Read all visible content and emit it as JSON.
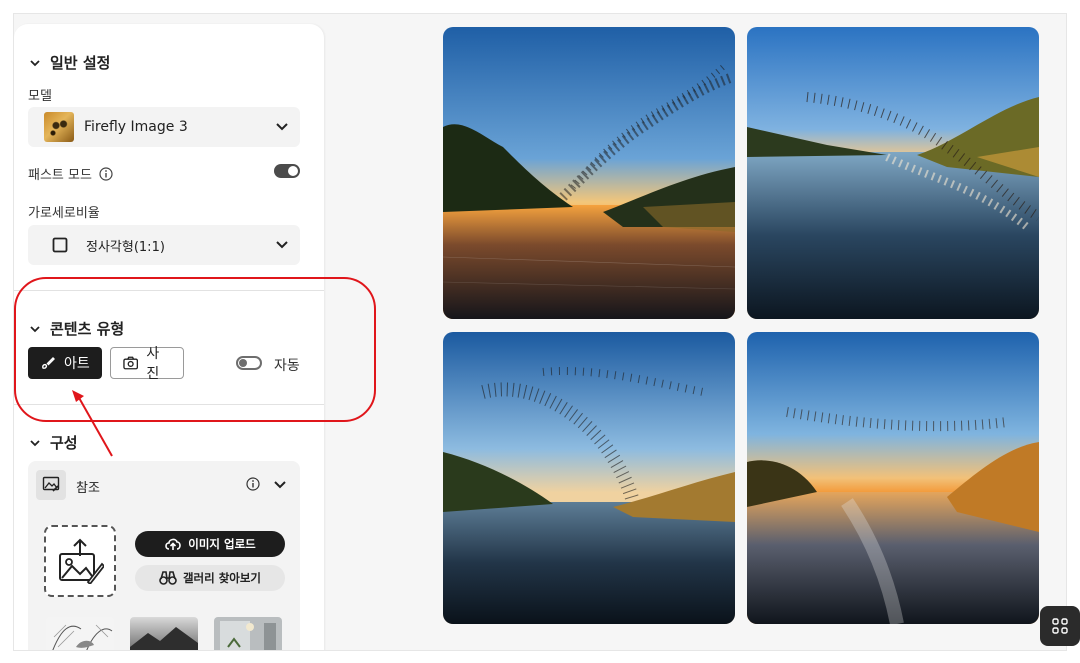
{
  "general": {
    "title": "일반 설정",
    "model_label": "모델",
    "model_value": "Firefly Image 3",
    "fast_mode_label": "패스트 모드",
    "fast_mode_on": true,
    "aspect_label": "가로세로비율",
    "aspect_value": "정사각형(1:1)"
  },
  "content_type": {
    "title": "콘텐츠 유형",
    "art_label": "아트",
    "photo_label": "사진",
    "auto_label": "자동",
    "selected": "아트",
    "auto_on": false
  },
  "composition": {
    "title": "구성",
    "reference_label": "참조",
    "upload_label": "이미지 업로드",
    "gallery_label": "갤러리 찾아보기"
  },
  "images": [
    {
      "alt": "river sunset birds 1"
    },
    {
      "alt": "river sunset birds 2"
    },
    {
      "alt": "river sunset birds 3"
    },
    {
      "alt": "river sunset birds 4"
    }
  ],
  "colors": {
    "annotation": "#e0161b",
    "accent_dark": "#1d1d1d"
  }
}
